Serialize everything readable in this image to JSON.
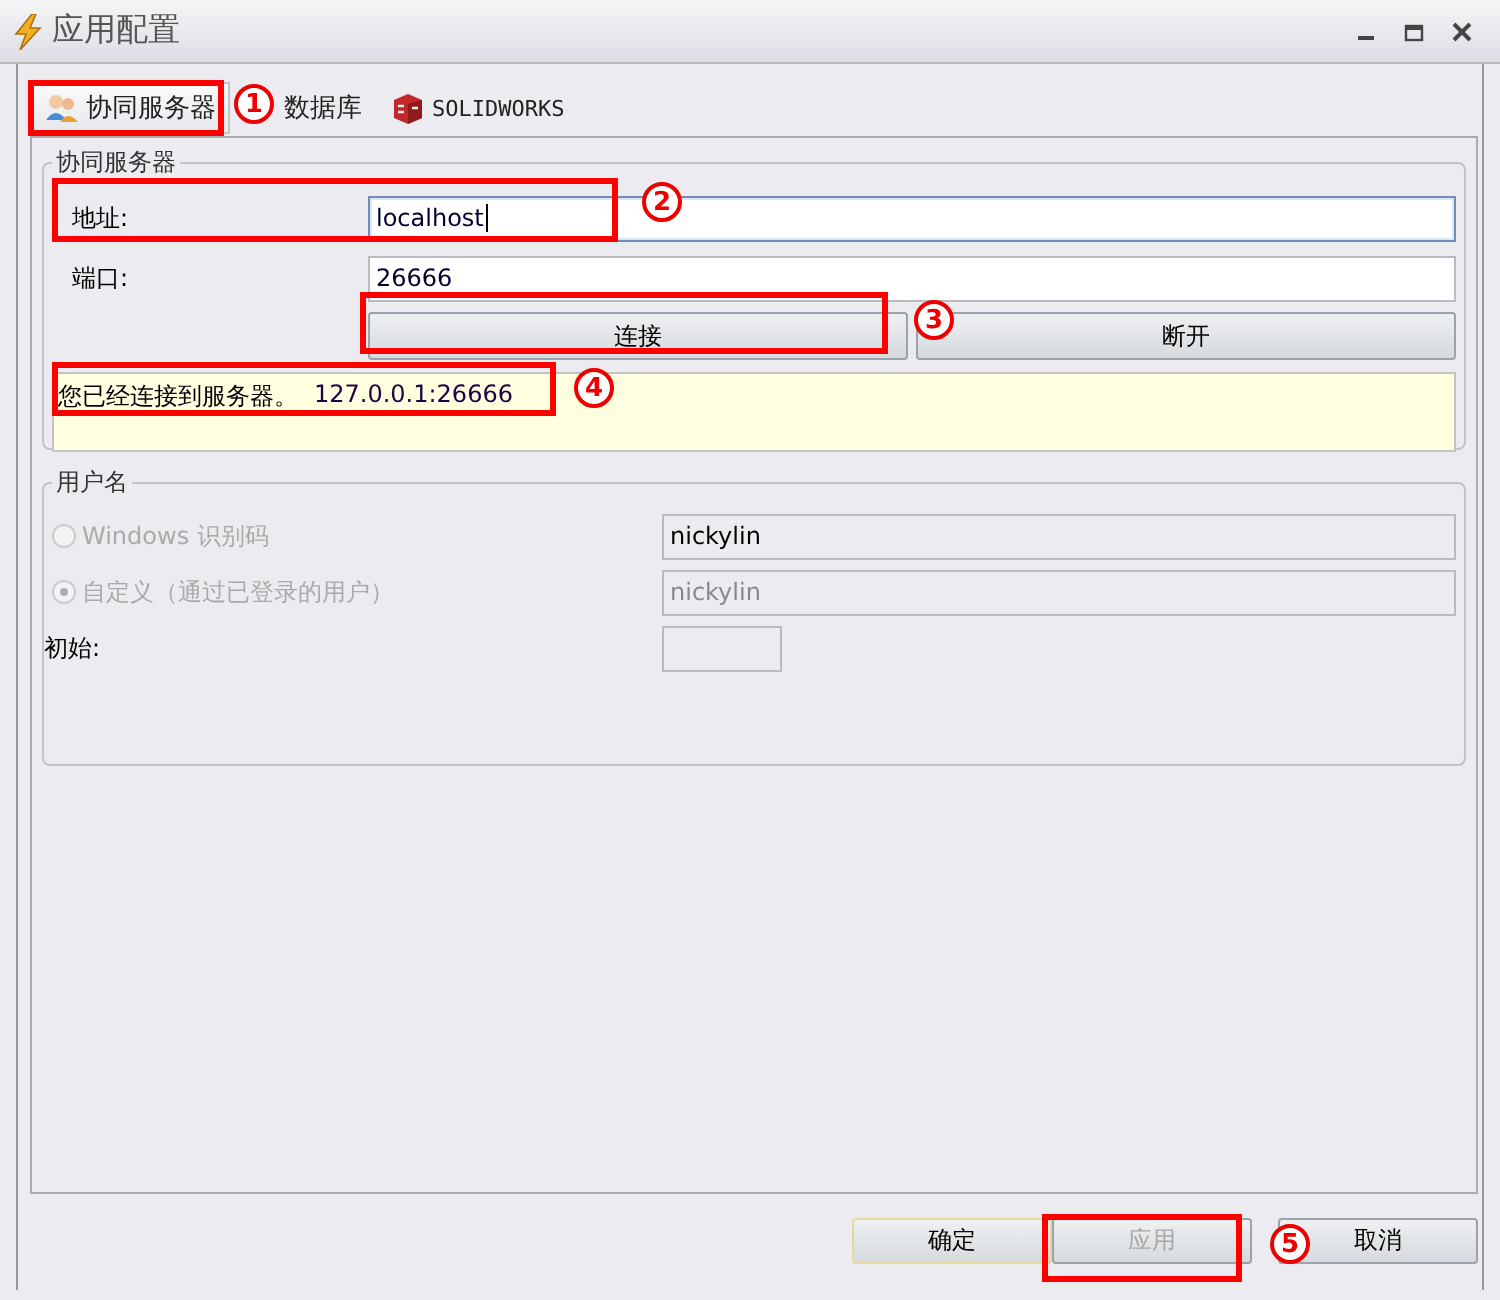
{
  "window": {
    "title": "应用配置"
  },
  "tabs": [
    {
      "label": "协同服务器",
      "selected": true
    },
    {
      "label": "数据库",
      "selected": false
    },
    {
      "label": "SOLIDWORKS",
      "selected": false
    }
  ],
  "server_group": {
    "title": "协同服务器",
    "fields": [
      {
        "label": "地址:",
        "value": "localhost",
        "focused": true
      },
      {
        "label": "端口:",
        "value": "26666",
        "focused": false
      }
    ],
    "buttons": [
      {
        "label": "连接"
      },
      {
        "label": "断开"
      }
    ],
    "status": {
      "message": "您已经连接到服务器。",
      "address": "127.0.0.1:26666"
    }
  },
  "user_group": {
    "title": "用户名",
    "options": [
      {
        "label": "Windows 识别码",
        "selected": false,
        "disabled": true,
        "field": {
          "value": "nickylin",
          "disabled": false
        }
      },
      {
        "label": "自定义（通过已登录的用户）",
        "selected": true,
        "disabled": true,
        "field": {
          "value": "nickylin",
          "disabled": true
        }
      }
    ],
    "initial": {
      "label": "初始:"
    }
  },
  "footer_buttons": [
    {
      "label": "确定",
      "default": true,
      "disabled": false
    },
    {
      "label": "应用",
      "default": false,
      "disabled": true
    },
    {
      "label": "取消",
      "default": false,
      "disabled": false
    }
  ],
  "annotations": [
    {
      "number": "1"
    },
    {
      "number": "2"
    },
    {
      "number": "3"
    },
    {
      "number": "4"
    },
    {
      "number": "5"
    }
  ]
}
